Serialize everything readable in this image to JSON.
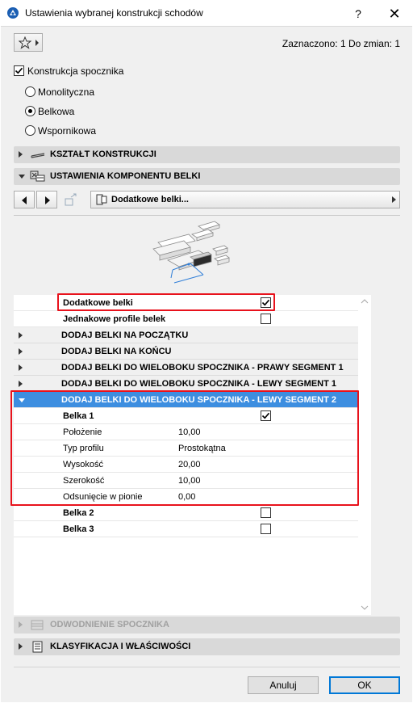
{
  "window": {
    "title": "Ustawienia wybranej konstrukcji schodów",
    "help": "?",
    "close": "✕"
  },
  "selection_info": "Zaznaczono: 1 Do zmian: 1",
  "structure": {
    "checkbox_label": "Konstrukcja spocznika",
    "checked": true,
    "options": [
      "Monolityczna",
      "Belkowa",
      "Wspornikowa"
    ],
    "selected": "Belkowa"
  },
  "panels": {
    "shape": "KSZTAŁT KONSTRUKCJI",
    "beam_settings": "USTAWIENIA KOMPONENTU BELKI",
    "drainage": "ODWODNIENIE SPOCZNIKA",
    "classification": "KLASYFIKACJA I WŁAŚCIWOŚCI"
  },
  "component_dropdown": "Dodatkowe belki...",
  "table": {
    "rows": [
      {
        "label": "Dodatkowe belki",
        "checked": true
      },
      {
        "label": "Jednakowe profile belek",
        "checked": false
      },
      {
        "label": "DODAJ BELKI NA POCZĄTKU"
      },
      {
        "label": "DODAJ BELKI NA KOŃCU"
      },
      {
        "label": "DODAJ BELKI DO WIELOBOKU SPOCZNIKA - PRAWY SEGMENT 1"
      },
      {
        "label": "DODAJ BELKI DO WIELOBOKU SPOCZNIKA - LEWY SEGMENT 1"
      },
      {
        "label": "DODAJ BELKI DO WIELOBOKU SPOCZNIKA - LEWY SEGMENT 2"
      },
      {
        "label": "Belka 1",
        "checked": true
      },
      {
        "label": "Położenie",
        "value": "10,00"
      },
      {
        "label": "Typ profilu",
        "value": "Prostokątna"
      },
      {
        "label": "Wysokość",
        "value": "20,00"
      },
      {
        "label": "Szerokość",
        "value": "10,00"
      },
      {
        "label": "Odsunięcie w pionie",
        "value": "0,00"
      },
      {
        "label": "Belka 2",
        "checked": false
      },
      {
        "label": "Belka 3",
        "checked": false
      }
    ]
  },
  "buttons": {
    "cancel": "Anuluj",
    "ok": "OK"
  },
  "colors": {
    "highlight": "#3d8ee0",
    "red_frame": "#e8121c"
  }
}
